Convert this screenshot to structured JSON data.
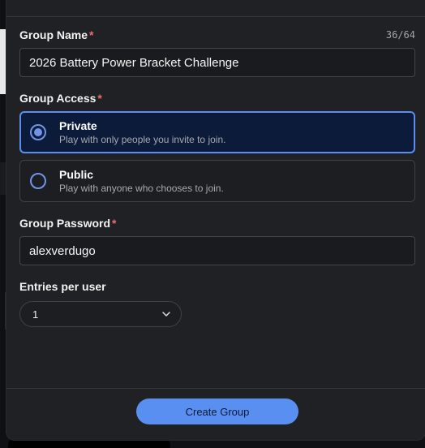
{
  "group_name": {
    "label": "Group Name",
    "required_mark": "*",
    "counter": "36/64",
    "value": "2026 Battery Power Bracket Challenge"
  },
  "group_access": {
    "label": "Group Access",
    "required_mark": "*",
    "options": [
      {
        "title": "Private",
        "subtitle": "Play with only people you invite to join.",
        "selected": true
      },
      {
        "title": "Public",
        "subtitle": "Play with anyone who chooses to join.",
        "selected": false
      }
    ]
  },
  "group_password": {
    "label": "Group Password",
    "required_mark": "*",
    "value": "alexverdugo"
  },
  "entries": {
    "label": "Entries per user",
    "selected": "1"
  },
  "footer": {
    "create_label": "Create Group"
  },
  "colors": {
    "accent": "#5a8ff2",
    "required": "#ef6b6b",
    "selected_bg": "#0c1b3a"
  }
}
